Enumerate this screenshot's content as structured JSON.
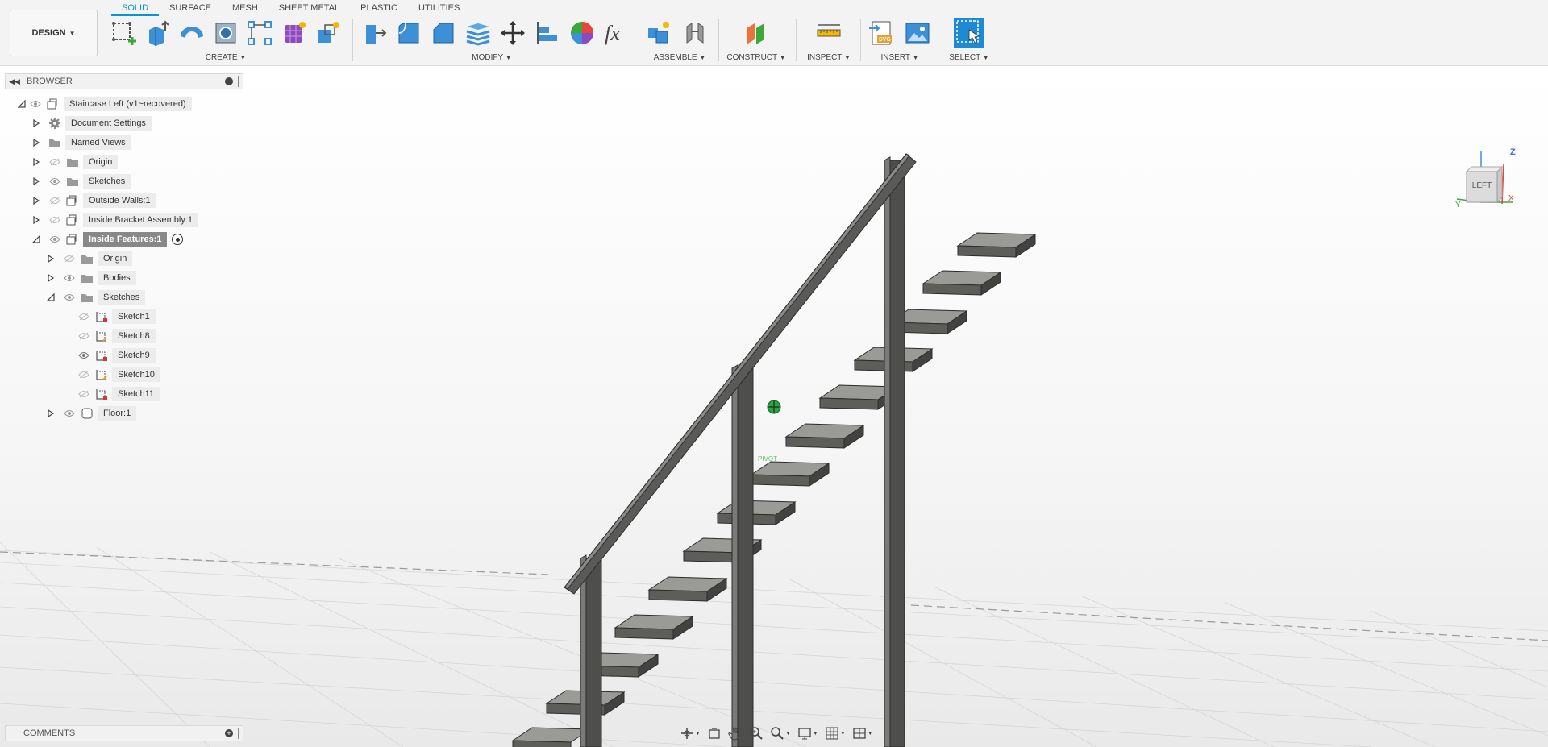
{
  "toolbar": {
    "workspace": "DESIGN",
    "tabs": [
      "SOLID",
      "SURFACE",
      "MESH",
      "SHEET METAL",
      "PLASTIC",
      "UTILITIES"
    ],
    "active_tab": "SOLID",
    "groups": {
      "create": "CREATE",
      "modify": "MODIFY",
      "assemble": "ASSEMBLE",
      "construct": "CONSTRUCT",
      "inspect": "INSPECT",
      "insert": "INSERT",
      "select": "SELECT"
    }
  },
  "browser": {
    "title": "BROWSER",
    "items": [
      {
        "label": "Staircase Left (v1~recovered)",
        "icon": "component-icon",
        "expanded": true
      },
      {
        "label": "Document Settings",
        "icon": "gear-icon"
      },
      {
        "label": "Named Views",
        "icon": "folder-icon"
      },
      {
        "label": "Origin",
        "icon": "folder-icon"
      },
      {
        "label": "Sketches",
        "icon": "folder-icon"
      },
      {
        "label": "Outside Walls:1",
        "icon": "component-icon"
      },
      {
        "label": "Inside Bracket Assembly:1",
        "icon": "component-icon"
      },
      {
        "label": "Inside Features:1",
        "icon": "component-icon",
        "expanded": true,
        "selected": true
      },
      {
        "label": "Origin",
        "icon": "folder-icon"
      },
      {
        "label": "Bodies",
        "icon": "folder-icon"
      },
      {
        "label": "Sketches",
        "icon": "folder-icon",
        "expanded": true
      },
      {
        "label": "Sketch1",
        "icon": "sketch-icon"
      },
      {
        "label": "Sketch8",
        "icon": "sketch-icon"
      },
      {
        "label": "Sketch9",
        "icon": "sketch-icon"
      },
      {
        "label": "Sketch10",
        "icon": "sketch-icon"
      },
      {
        "label": "Sketch11",
        "icon": "sketch-icon"
      },
      {
        "label": "Floor:1",
        "icon": "body-icon"
      }
    ]
  },
  "viewport": {
    "viewcube_face": "LEFT",
    "axis_z": "Z",
    "axis_y": "Y",
    "axis_x": "X",
    "pivot_label": "PIVOT"
  },
  "comments": {
    "title": "COMMENTS"
  },
  "colors": {
    "accent": "#0696d7",
    "tread": "#5d5d5a",
    "pivot": "#2ea043"
  }
}
